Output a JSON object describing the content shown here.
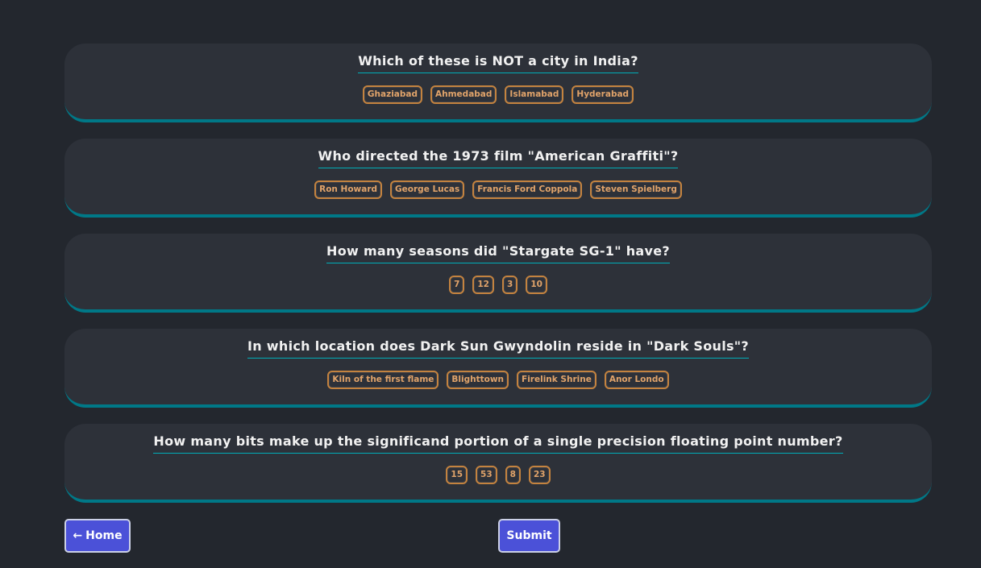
{
  "questions": [
    {
      "text": "Which of these is NOT a city in India?",
      "answers": [
        "Ghaziabad",
        "Ahmedabad",
        "Islamabad",
        "Hyderabad"
      ]
    },
    {
      "text": "Who directed the 1973 film \"American Graffiti\"?",
      "answers": [
        "Ron Howard",
        "George Lucas",
        "Francis Ford Coppola",
        "Steven Spielberg"
      ]
    },
    {
      "text": "How many seasons did \"Stargate SG-1\" have?",
      "answers": [
        "7",
        "12",
        "3",
        "10"
      ]
    },
    {
      "text": "In which location does Dark Sun Gwyndolin reside in \"Dark Souls\"?",
      "answers": [
        "Kiln of the first flame",
        "Blighttown",
        "Firelink Shrine",
        "Anor Londo"
      ]
    },
    {
      "text": "How many bits make up the significand portion of a single precision floating point number?",
      "answers": [
        "15",
        "53",
        "8",
        "23"
      ]
    }
  ],
  "nav": {
    "home_arrow": "←",
    "home_label": "Home",
    "submit_label": "Submit"
  },
  "colors": {
    "background": "#23272e",
    "card": "#2d3139",
    "card_border": "#007887",
    "answer_text": "#e0a36a",
    "answer_border": "#c4833f",
    "button": "#4b51d8"
  }
}
